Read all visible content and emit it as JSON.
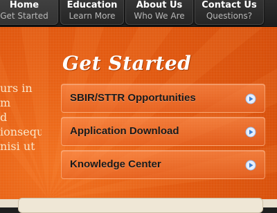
{
  "nav": {
    "items": [
      {
        "title": "Home",
        "subtitle": "Get Started"
      },
      {
        "title": "Education",
        "subtitle": "Learn More"
      },
      {
        "title": "About Us",
        "subtitle": "Who We Are"
      },
      {
        "title": "Contact Us",
        "subtitle": "Questions?"
      }
    ],
    "active_index": 0
  },
  "hero": {
    "title": "Get Started",
    "left_text_lines": [
      "urs in",
      "m",
      "d",
      "ionsequat ad",
      "nisi ut"
    ],
    "buttons": [
      {
        "label": "SBIR/STTR Opportunities",
        "icon": "arrow-circle-icon"
      },
      {
        "label": "Application Download",
        "icon": "arrow-circle-icon"
      },
      {
        "label": "Knowledge Center",
        "icon": "arrow-circle-icon"
      }
    ]
  },
  "colors": {
    "orange": "#e35a10",
    "nav_bg": "#252525",
    "cream": "#e9e0cf",
    "arrow_blue": "#3b7fd0"
  }
}
